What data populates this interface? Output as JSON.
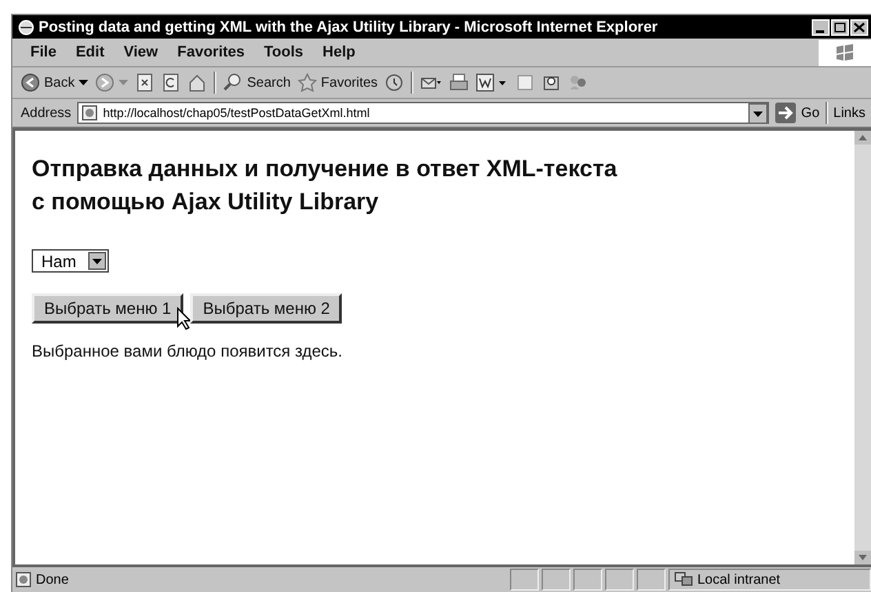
{
  "window": {
    "title": "Posting data and getting XML with the Ajax Utility Library - Microsoft Internet Explorer"
  },
  "menu": [
    "File",
    "Edit",
    "View",
    "Favorites",
    "Tools",
    "Help"
  ],
  "toolbar": [
    {
      "kind": "back",
      "label": "Back"
    },
    {
      "kind": "forward"
    },
    {
      "kind": "stop"
    },
    {
      "kind": "refresh"
    },
    {
      "kind": "home"
    },
    {
      "kind": "search",
      "label": "Search"
    },
    {
      "kind": "favorites",
      "label": "Favorites"
    },
    {
      "kind": "history"
    },
    {
      "kind": "mail"
    },
    {
      "kind": "print"
    },
    {
      "kind": "edit"
    },
    {
      "kind": "discuss"
    },
    {
      "kind": "research"
    },
    {
      "kind": "messenger"
    }
  ],
  "address": {
    "label": "Address",
    "url": "http://localhost/chap05/testPostDataGetXml.html",
    "go": "Go",
    "links": "Links"
  },
  "page": {
    "heading": [
      "Отправка данных и получение в ответ XML-текста",
      "с помощью Ajax Utility Library"
    ],
    "select": {
      "value": "Ham"
    },
    "buttons": [
      "Выбрать меню 1",
      "Выбрать меню 2"
    ],
    "message": "Выбранное вами блюдо появится здесь."
  },
  "status_bar": {
    "text": "Done",
    "zone": "Local intranet"
  }
}
